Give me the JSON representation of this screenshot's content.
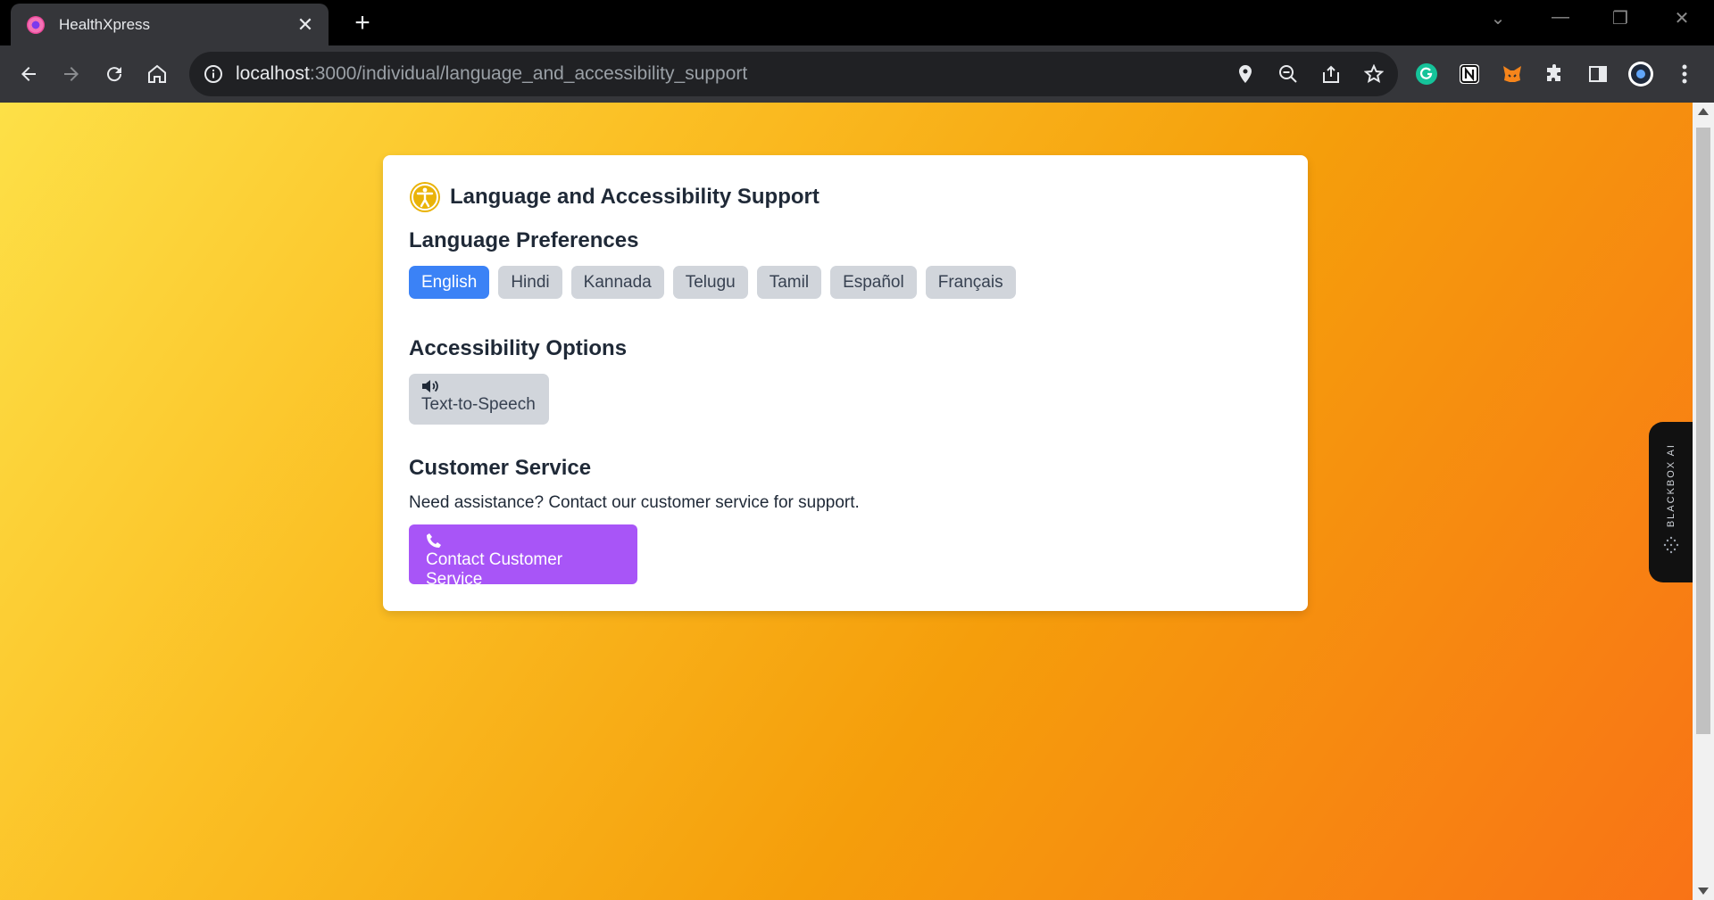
{
  "browser": {
    "tab_title": "HealthXpress",
    "url_host": "localhost",
    "url_path": ":3000/individual/language_and_accessibility_support"
  },
  "card": {
    "title": "Language and Accessibility Support",
    "language_section": {
      "title": "Language Preferences",
      "options": [
        "English",
        "Hindi",
        "Kannada",
        "Telugu",
        "Tamil",
        "Español",
        "Français"
      ],
      "selected": "English"
    },
    "accessibility_section": {
      "title": "Accessibility Options",
      "tts_label": "Text-to-Speech"
    },
    "customer_service": {
      "title": "Customer Service",
      "text": "Need assistance? Contact our customer service for support.",
      "button_label": "Contact Customer Service"
    }
  },
  "sidebar_widget": {
    "label": "BLACKBOX AI"
  },
  "colors": {
    "primary_blue": "#3b82f6",
    "purple": "#a855f7",
    "gradient_start": "#fde047",
    "gradient_end": "#f97316",
    "accent_yellow": "#eab308"
  }
}
